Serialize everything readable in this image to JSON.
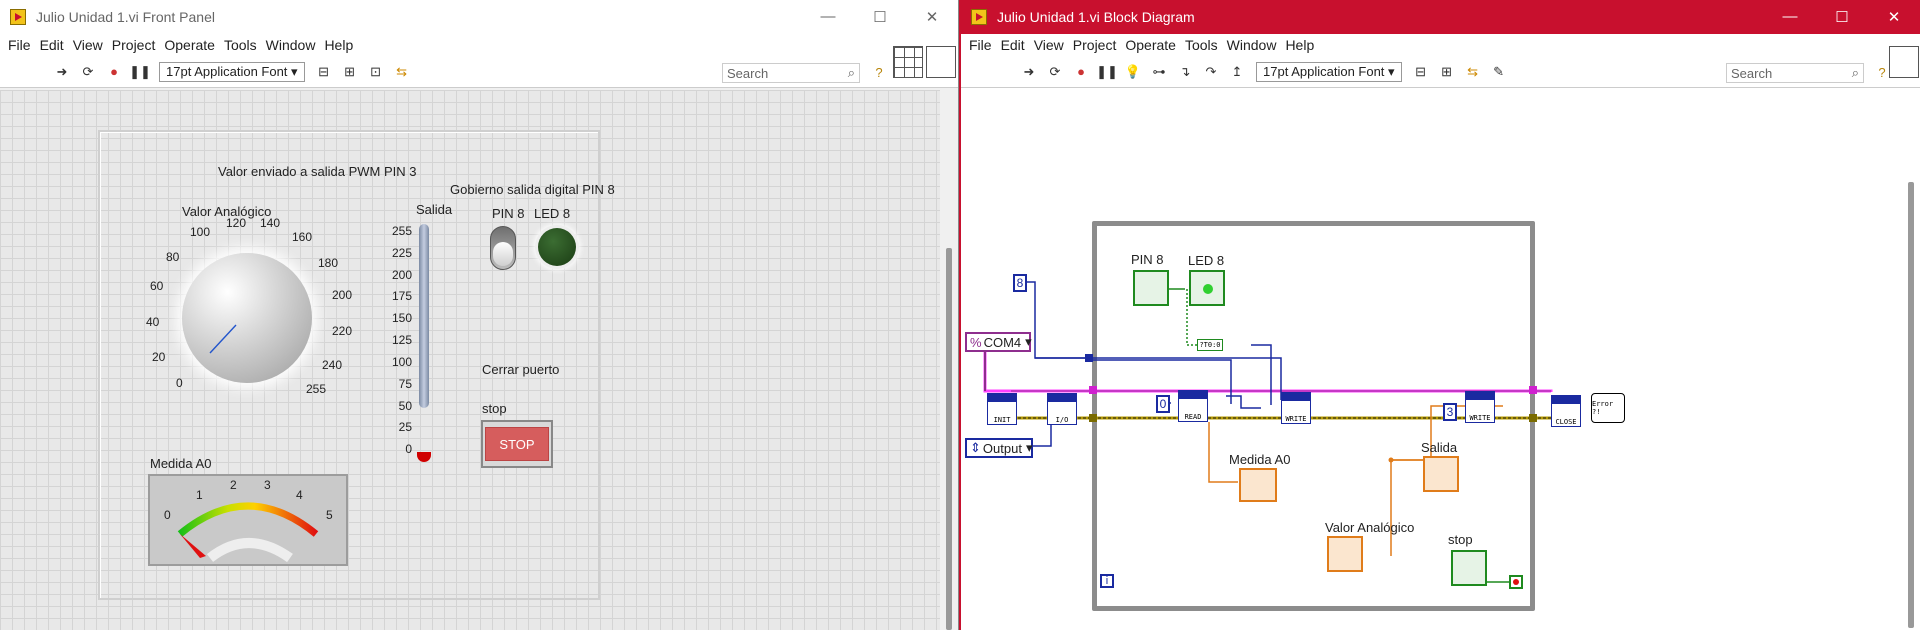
{
  "front_panel": {
    "title": "Julio Unidad 1.vi Front Panel",
    "window_controls": {
      "minimize": "—",
      "maximize": "☐",
      "close": "✕"
    },
    "menu": [
      "File",
      "Edit",
      "View",
      "Project",
      "Operate",
      "Tools",
      "Window",
      "Help"
    ],
    "font_select": "17pt Application Font",
    "search_placeholder": "Search",
    "labels": {
      "pwm_caption": "Valor enviado a salida PWM PIN 3",
      "digital_caption": "Gobierno salida digital PIN 8",
      "knob_label": "Valor Analógico",
      "slider_label": "Salida",
      "pin8_label": "PIN 8",
      "led8_label": "LED 8",
      "close_port": "Cerrar puerto",
      "stop_label": "stop",
      "stop_button": "STOP",
      "meter_label": "Medida A0"
    },
    "knob_ticks": [
      "0",
      "20",
      "40",
      "60",
      "80",
      "100",
      "120",
      "140",
      "160",
      "180",
      "200",
      "220",
      "240",
      "255"
    ],
    "slider_ticks": [
      "255",
      "225",
      "200",
      "175",
      "150",
      "125",
      "100",
      "75",
      "50",
      "25",
      "0"
    ],
    "meter_ticks": [
      "0",
      "1",
      "2",
      "3",
      "4",
      "5"
    ],
    "knob_value": 18,
    "slider_value": 0,
    "meter_value": 0
  },
  "block_diagram": {
    "title": "Julio Unidad 1.vi Block Diagram",
    "window_controls": {
      "minimize": "—",
      "maximize": "☐",
      "close": "✕"
    },
    "menu": [
      "File",
      "Edit",
      "View",
      "Project",
      "Operate",
      "Tools",
      "Window",
      "Help"
    ],
    "font_select": "17pt Application Font",
    "search_placeholder": "Search",
    "nodes": {
      "init": "INIT",
      "io": "I/O",
      "read": "READ",
      "write1": "WRITE",
      "write2": "WRITE",
      "close": "CLOSE",
      "error": "Error ?!",
      "const8": "8",
      "const0": "0",
      "const3": "3",
      "com": "COM4",
      "output": "Output",
      "tf": "?T0:0",
      "iter": "i"
    },
    "labels": {
      "pin8": "PIN 8",
      "led8": "LED 8",
      "medida": "Medida A0",
      "salida": "Salida",
      "valor": "Valor Analógico",
      "stop": "stop"
    }
  }
}
